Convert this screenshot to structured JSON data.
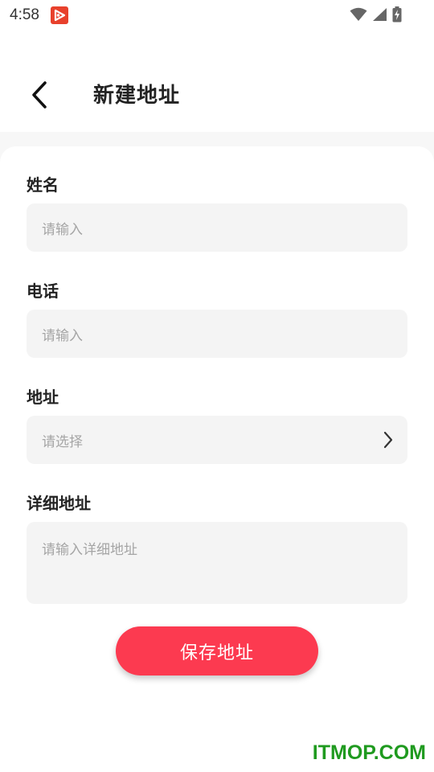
{
  "status_bar": {
    "time": "4:58",
    "icons": [
      "app-notification-icon",
      "wifi-icon",
      "cell-signal-icon",
      "battery-charging-icon"
    ]
  },
  "header": {
    "back_icon": "chevron-left-icon",
    "title": "新建地址"
  },
  "form": {
    "name": {
      "label": "姓名",
      "placeholder": "请输入",
      "value": ""
    },
    "phone": {
      "label": "电话",
      "placeholder": "请输入",
      "value": ""
    },
    "address": {
      "label": "地址",
      "placeholder": "请选择",
      "value": "",
      "icon": "chevron-right-icon"
    },
    "detail": {
      "label": "详细地址",
      "placeholder": "请输入详细地址",
      "value": ""
    }
  },
  "save_button": {
    "label": "保存地址"
  },
  "watermark": {
    "text": "ITMOP.COM"
  },
  "colors": {
    "accent": "#fc3a50",
    "page_background": "#f7f7f7",
    "card_background": "#ffffff",
    "field_background": "#f4f4f4",
    "placeholder_text": "#a5a5a5",
    "watermark": "#1f9a1f"
  }
}
